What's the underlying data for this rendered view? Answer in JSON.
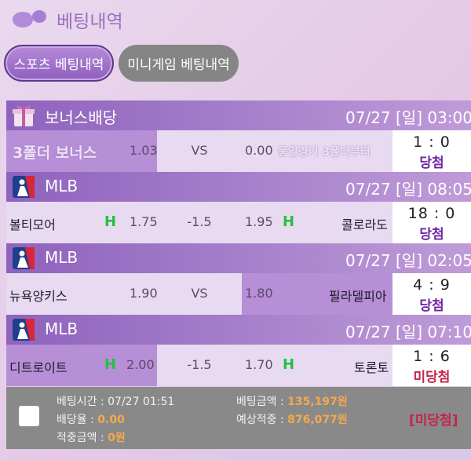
{
  "header": {
    "title": "베팅내역",
    "logo_icon": "purple-blob-icon"
  },
  "tabs": [
    {
      "label": "스포츠 베팅내역",
      "active": true
    },
    {
      "label": "미니게임 베팅내역",
      "active": false
    }
  ],
  "groups": [
    {
      "icon": "gift-box-icon",
      "name": "보너스배당",
      "date": "07/27 [일] 03:00",
      "row": {
        "bonus_label": "3폴더 보너스",
        "home_odds": "1.03",
        "mid": "VS",
        "away_odds": "0.00",
        "note": "동일경기 3폴더부터",
        "score": "1 : 0",
        "status": "당첨"
      }
    },
    {
      "icon": "mlb-logo-icon",
      "name": "MLB",
      "date": "07/27 [일] 08:05",
      "row": {
        "home_team": "볼티모어",
        "home_mark": "H",
        "home_odds": "1.75",
        "mid": "-1.5",
        "away_odds": "1.95",
        "away_mark": "H",
        "away_team": "콜로라도",
        "score": "18 : 0",
        "status": "당첨"
      }
    },
    {
      "icon": "mlb-logo-icon",
      "name": "MLB",
      "date": "07/27 [일] 02:05",
      "row": {
        "home_team": "뉴욕양키스",
        "home_odds": "1.90",
        "mid": "VS",
        "away_odds": "1.80",
        "away_team": "필라델피아",
        "score": "4 : 9",
        "status": "당첨"
      }
    },
    {
      "icon": "mlb-logo-icon",
      "name": "MLB",
      "date": "07/27 [일] 07:10",
      "row": {
        "home_team": "디트로이트",
        "home_mark": "H",
        "home_odds": "2.00",
        "mid": "-1.5",
        "away_odds": "1.70",
        "away_mark": "H",
        "away_team": "토론토",
        "score": "1 : 6",
        "status": "미당첨"
      }
    }
  ],
  "summary": {
    "bet_time_label": "베팅시간 : ",
    "bet_time": "07/27 01:51",
    "odds_label": "배당율 : ",
    "odds": "0.00",
    "win_amount_label": "적중금액 : ",
    "win_amount": "0원",
    "bet_amount_label": "베팅금액 : ",
    "bet_amount": "135,197원",
    "expected_label": "예상적중 : ",
    "expected": "876,077원",
    "final_status": "[미당첨]"
  },
  "colors": {
    "accent_purple": "#8f62bd",
    "win": "#6e25a5",
    "lose": "#c4254a",
    "home_mark": "#22c23e",
    "amount": "#f4a94d"
  }
}
